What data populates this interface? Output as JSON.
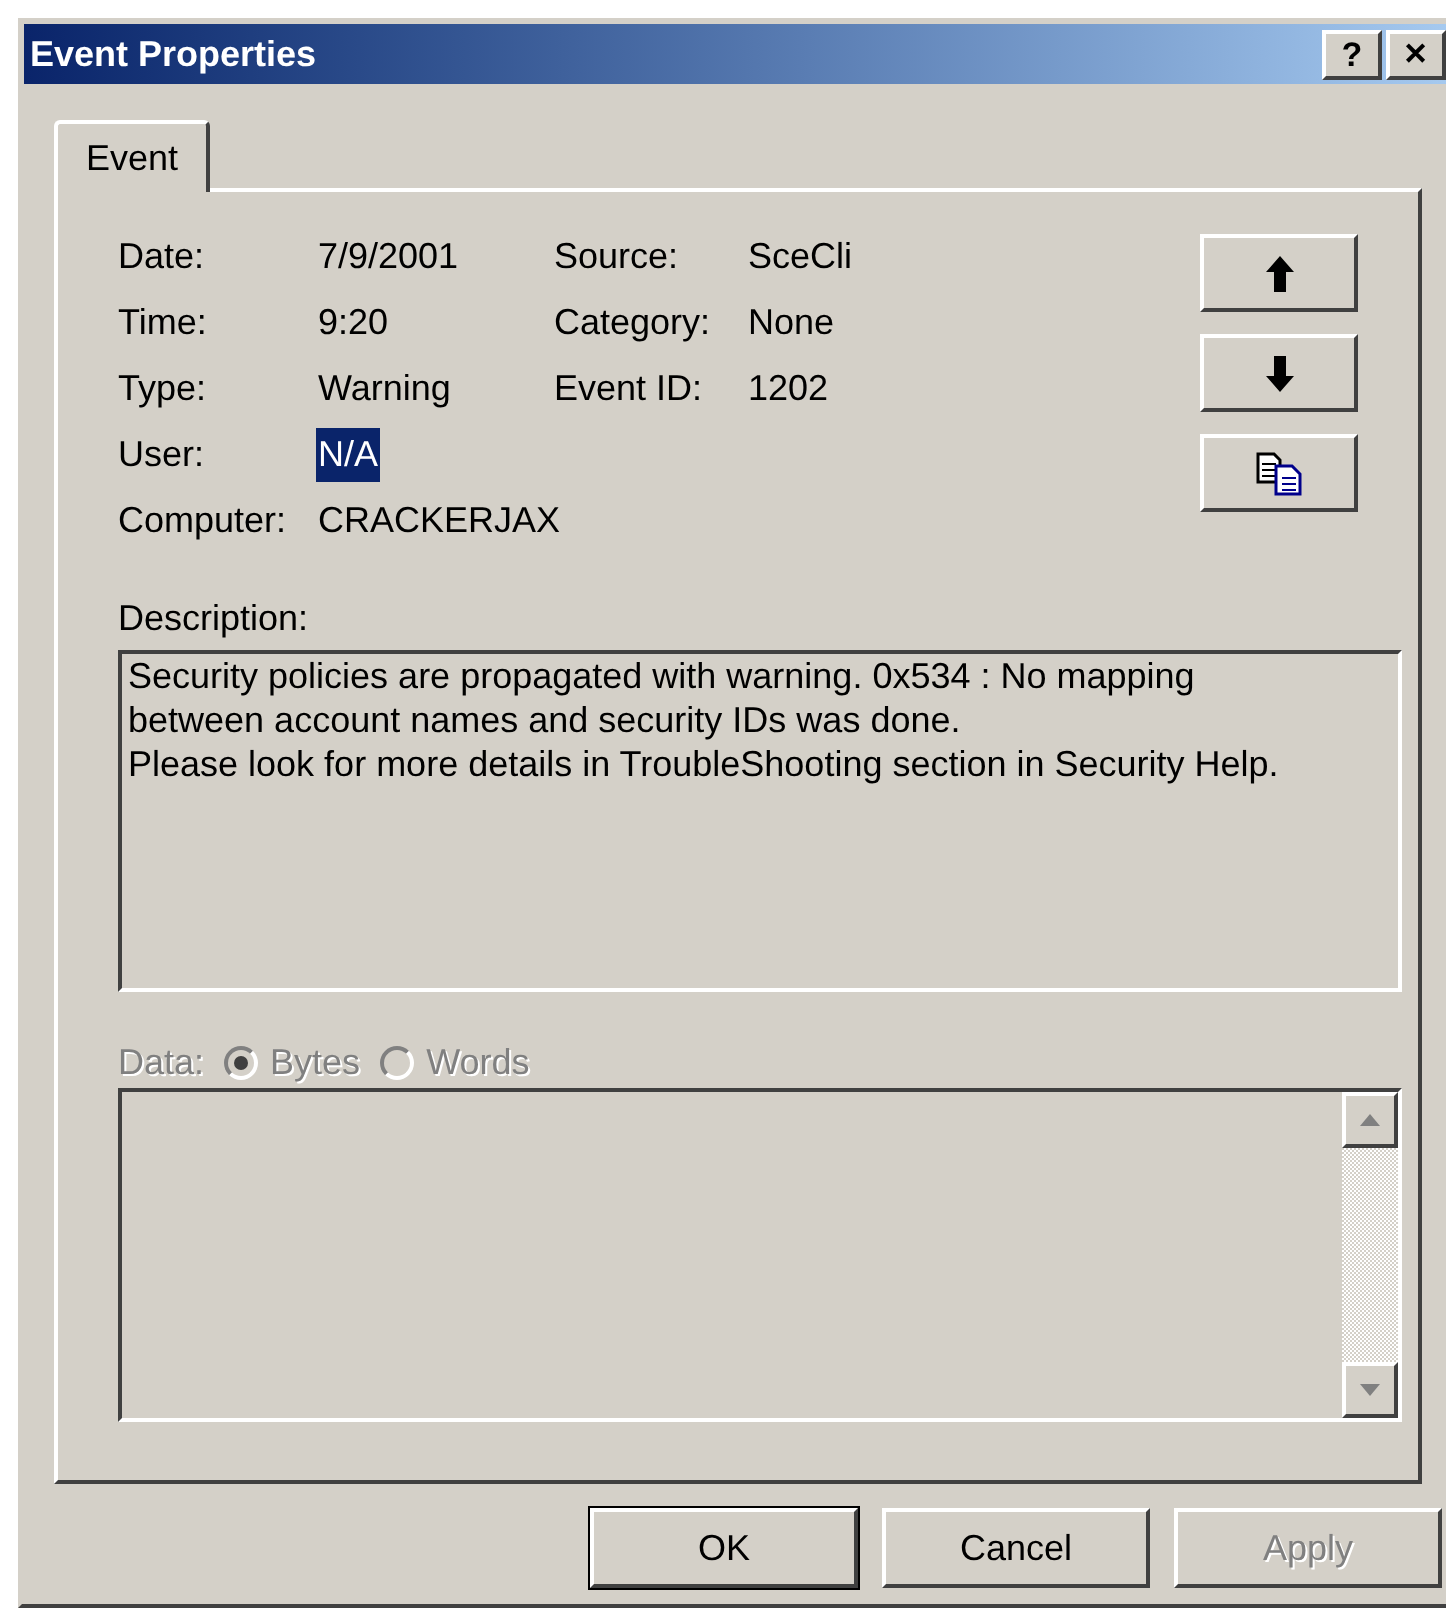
{
  "window": {
    "title": "Event Properties",
    "help_button": "?",
    "close_button": "✕"
  },
  "tabs": [
    {
      "label": "Event",
      "selected": true
    }
  ],
  "fields": [
    {
      "label": "Date:",
      "value": "7/9/2001",
      "selected": false
    },
    {
      "label": "Time:",
      "value": "9:20",
      "selected": false
    },
    {
      "label": "Type:",
      "value": "Warning",
      "selected": false
    },
    {
      "label": "User:",
      "value": "N/A",
      "selected": true
    },
    {
      "label": "Computer:",
      "value": "CRACKERJAX",
      "selected": false
    }
  ],
  "fields_right": [
    {
      "label": "Source:",
      "value": "SceCli"
    },
    {
      "label": "Category:",
      "value": "None"
    },
    {
      "label": "Event ID:",
      "value": "1202"
    }
  ],
  "side_buttons": [
    {
      "kind": "up"
    },
    {
      "kind": "down"
    },
    {
      "kind": "copy"
    }
  ],
  "description": {
    "label": "Description:",
    "lines": [
      "Security policies are propagated with warning. 0x534 : No mapping",
      "between account names and security IDs was done.",
      "Please look for more details in TroubleShooting section in Security Help."
    ]
  },
  "data": {
    "label": "Data:",
    "disabled": true,
    "options": [
      {
        "label": "Bytes",
        "selected": true
      },
      {
        "label": "Words",
        "selected": false
      }
    ]
  },
  "buttons": [
    {
      "label": "OK",
      "default": true,
      "disabled": false
    },
    {
      "label": "Cancel",
      "default": false,
      "disabled": false
    },
    {
      "label": "Apply",
      "default": false,
      "disabled": true
    }
  ]
}
